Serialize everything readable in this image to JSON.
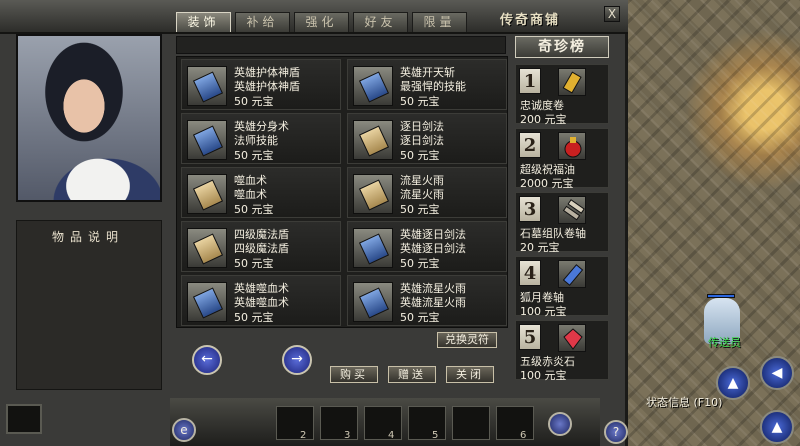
{
  "window": {
    "title": "传奇商铺",
    "close_label": "X",
    "tabs": [
      "装饰",
      "补给",
      "强化",
      "好友",
      "限量"
    ],
    "active_tab": 0
  },
  "description_title": "物品说明",
  "items": [
    {
      "name": "英雄护体神盾",
      "desc": "英雄护体神盾",
      "price": "50 元宝",
      "icon": "blue-book-icon"
    },
    {
      "name": "英雄开天斩",
      "desc": "最强悍的技能",
      "price": "50 元宝",
      "icon": "blue-book-icon"
    },
    {
      "name": "英雄分身术",
      "desc": "法师技能",
      "price": "50 元宝",
      "icon": "blue-book-icon"
    },
    {
      "name": "逐日剑法",
      "desc": "逐日剑法",
      "price": "50 元宝",
      "icon": "tan-book-icon"
    },
    {
      "name": "噬血术",
      "desc": "噬血术",
      "price": "50 元宝",
      "icon": "tan-book-icon"
    },
    {
      "name": "流星火雨",
      "desc": "流星火雨",
      "price": "50 元宝",
      "icon": "tan-book-icon"
    },
    {
      "name": "四级魔法盾",
      "desc": "四级魔法盾",
      "price": "50 元宝",
      "icon": "tan-book-icon"
    },
    {
      "name": "英雄逐日剑法",
      "desc": "英雄逐日剑法",
      "price": "50 元宝",
      "icon": "blue-book-icon"
    },
    {
      "name": "英雄噬血术",
      "desc": "英雄噬血术",
      "price": "50 元宝",
      "icon": "blue-book-icon"
    },
    {
      "name": "英雄流星火雨",
      "desc": "英雄流星火雨",
      "price": "50 元宝",
      "icon": "blue-book-icon"
    }
  ],
  "buttons": {
    "redeem": "兑换灵符",
    "buy": "购买",
    "gift": "赠送",
    "close": "关闭",
    "prev_page": "←",
    "next_page": "→"
  },
  "ranking": {
    "title": "奇珍榜",
    "entries": [
      {
        "rank": "1",
        "name": "忠诚度卷",
        "price": "200 元宝",
        "icon": "scroll-icon"
      },
      {
        "rank": "2",
        "name": "超级祝福油",
        "price": "2000 元宝",
        "icon": "potion-icon"
      },
      {
        "rank": "3",
        "name": "石墓组队卷轴",
        "price": "20 元宝",
        "icon": "scroll-bundle-icon"
      },
      {
        "rank": "4",
        "name": "狐月卷轴",
        "price": "100 元宝",
        "icon": "blue-scroll-icon"
      },
      {
        "rank": "5",
        "name": "五级赤炎石",
        "price": "100 元宝",
        "icon": "red-gem-icon"
      }
    ]
  },
  "hud": {
    "npc_name": "传送员",
    "status_info": "状态信息 (F10)",
    "slot_numbers": [
      "2",
      "3",
      "4",
      "5",
      "6"
    ],
    "letter_button": "e",
    "help_button": "?"
  }
}
